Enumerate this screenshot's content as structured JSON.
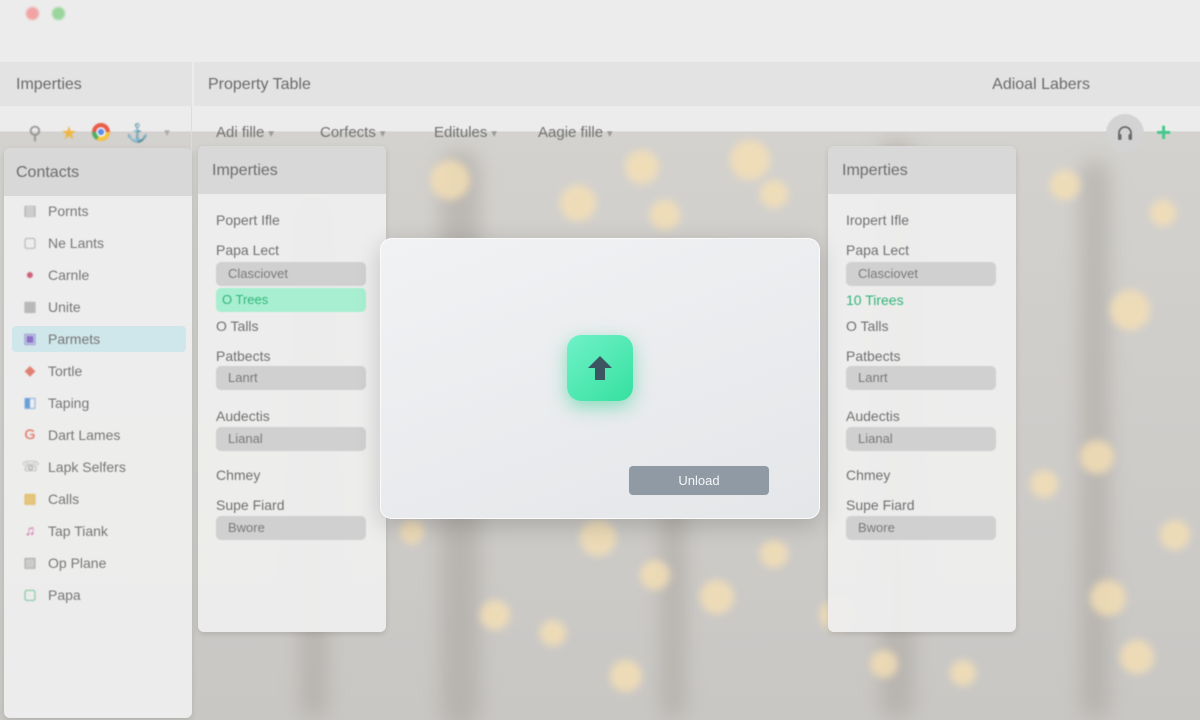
{
  "sidebar": {
    "title": "Imperties"
  },
  "main": {
    "title": "Property Table",
    "right_title": "Adioal Labers"
  },
  "toolbar": {
    "icons": [
      "search-icon",
      "star-icon",
      "chrome-icon",
      "anchor-icon",
      "chevron-down-icon"
    ],
    "menus": [
      {
        "label": "Adi fille"
      },
      {
        "label": "Corfects"
      },
      {
        "label": "Editules"
      },
      {
        "label": "Aagie fille"
      }
    ],
    "add_label": "+"
  },
  "contacts": {
    "title": "Contacts",
    "items": [
      {
        "label": "Pornts",
        "icon": "document-icon",
        "active": false
      },
      {
        "label": "Ne Lants",
        "icon": "file-icon",
        "active": false
      },
      {
        "label": "Carnle",
        "icon": "color-drop-icon",
        "active": false
      },
      {
        "label": "Unite",
        "icon": "grid-icon",
        "active": false
      },
      {
        "label": "Parmets",
        "icon": "app-icon",
        "active": true
      },
      {
        "label": "Tortle",
        "icon": "shapes-icon",
        "active": false
      },
      {
        "label": "Taping",
        "icon": "tag-icon",
        "active": false
      },
      {
        "label": "Dart Lames",
        "icon": "google-icon",
        "active": false
      },
      {
        "label": "Lapk Selfers",
        "icon": "phone-icon",
        "active": false
      },
      {
        "label": "Calls",
        "icon": "notes-icon",
        "active": false
      },
      {
        "label": "Tap Tiank",
        "icon": "music-icon",
        "active": false
      },
      {
        "label": "Op Plane",
        "icon": "image-icon",
        "active": false
      },
      {
        "label": "Papa",
        "icon": "box-icon",
        "active": false
      }
    ]
  },
  "props_left": {
    "title": "Imperties",
    "rows": [
      {
        "kind": "label",
        "text": "Popert Ifle"
      },
      {
        "kind": "label",
        "text": "Papa Lect"
      },
      {
        "kind": "field",
        "text": "Clasciovet"
      },
      {
        "kind": "green-bar",
        "text": "O Trees"
      },
      {
        "kind": "label",
        "text": "O Talls"
      },
      {
        "kind": "label",
        "text": "Patbects"
      },
      {
        "kind": "field",
        "text": "Lanrt"
      },
      {
        "kind": "label",
        "text": "Audectis"
      },
      {
        "kind": "field",
        "text": "Lianal"
      },
      {
        "kind": "label",
        "text": "Chmey"
      },
      {
        "kind": "label",
        "text": "Supe Fiard"
      },
      {
        "kind": "field",
        "text": "Bwore"
      }
    ]
  },
  "props_right": {
    "title": "Imperties",
    "rows": [
      {
        "kind": "label",
        "text": "Iropert Ifle"
      },
      {
        "kind": "label",
        "text": "Papa Lect"
      },
      {
        "kind": "field",
        "text": "Clasciovet"
      },
      {
        "kind": "green-text",
        "text": "10 Tirees"
      },
      {
        "kind": "label",
        "text": "O Talls"
      },
      {
        "kind": "label",
        "text": "Patbects"
      },
      {
        "kind": "field",
        "text": "Lanrt"
      },
      {
        "kind": "label",
        "text": "Audectis"
      },
      {
        "kind": "field",
        "text": "Lianal"
      },
      {
        "kind": "label",
        "text": "Chmey"
      },
      {
        "kind": "label",
        "text": "Supe Fiard"
      },
      {
        "kind": "field",
        "text": "Bwore"
      }
    ]
  },
  "dialog": {
    "button_label": "Unload",
    "icon": "upload-arrow-icon"
  },
  "colors": {
    "accent": "#44c98a",
    "upload_icon": "#4de8b0",
    "button": "#8f9aa5"
  }
}
